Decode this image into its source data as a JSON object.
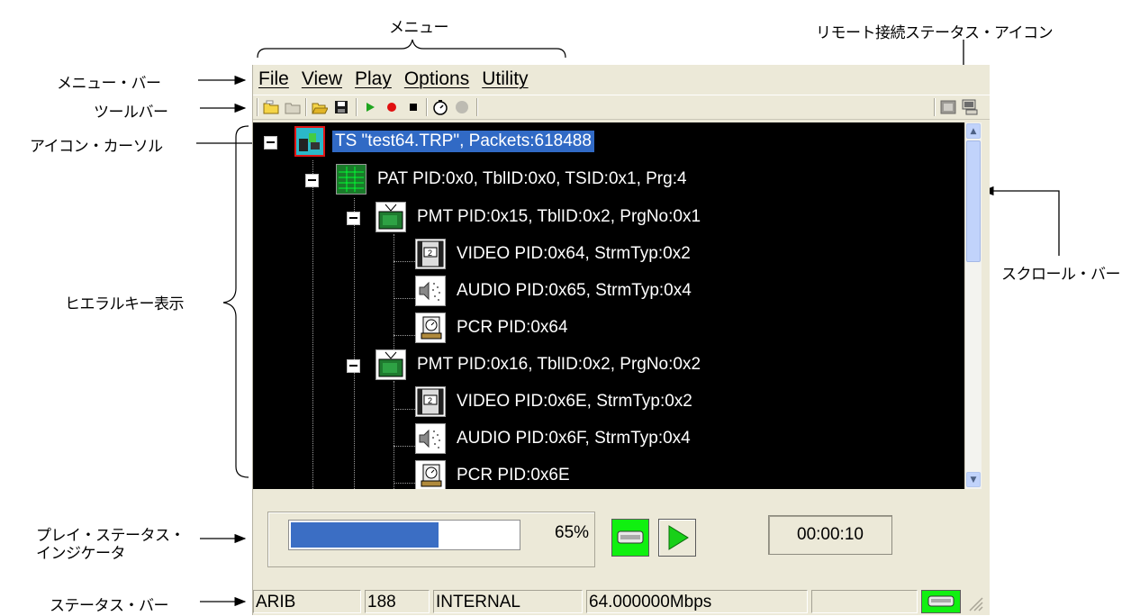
{
  "callouts": {
    "menu": "メニュー",
    "remote_icon": "リモート接続ステータス・アイコン",
    "menu_bar": "メニュー・バー",
    "toolbar": "ツールバー",
    "icon_cursor": "アイコン・カーソル",
    "hierarchy": "ヒエラルキー表示",
    "scroll_bar": "スクロール・バー",
    "play_status_line1": "プレイ・ステータス・",
    "play_status_line2": "インジケータ",
    "status_bar": "ステータス・バー"
  },
  "menu": {
    "items": [
      "File",
      "View",
      "Play",
      "Options",
      "Utility"
    ]
  },
  "toolbar": {
    "icons": [
      "new-folder-icon",
      "folder-icon",
      "open-icon",
      "save-icon",
      "play-icon",
      "record-icon",
      "stop-icon",
      "timer-icon",
      "status-light-icon"
    ],
    "right_icons": [
      "remote-image-icon",
      "remote-connection-icon"
    ]
  },
  "tree": {
    "nodes": [
      {
        "label": "TS \"test64.TRP\", Packets:618488",
        "icon": "transport-stream-icon",
        "selected": true
      },
      {
        "label": "PAT PID:0x0, TblID:0x0, TSID:0x1, Prg:4",
        "icon": "pat-table-icon"
      },
      {
        "label": "PMT PID:0x15, TblID:0x2, PrgNo:0x1",
        "icon": "tv-icon"
      },
      {
        "label": "VIDEO PID:0x64, StrmTyp:0x2",
        "icon": "film-icon"
      },
      {
        "label": "AUDIO PID:0x65, StrmTyp:0x4",
        "icon": "speaker-icon"
      },
      {
        "label": "PCR PID:0x64",
        "icon": "clock-icon"
      },
      {
        "label": "PMT PID:0x16, TblID:0x2, PrgNo:0x2",
        "icon": "tv-icon"
      },
      {
        "label": "VIDEO PID:0x6E, StrmTyp:0x2",
        "icon": "film-icon"
      },
      {
        "label": "AUDIO PID:0x6F, StrmTyp:0x4",
        "icon": "speaker-icon"
      },
      {
        "label": "PCR PID:0x6E",
        "icon": "clock-icon"
      }
    ]
  },
  "play": {
    "progress_percent": 65,
    "progress_text": "65%",
    "time": "00:00:10"
  },
  "status": {
    "standard": "ARIB",
    "packet_size": "188",
    "clock": "INTERNAL",
    "rate": "64.000000Mbps",
    "empty": ""
  },
  "colors": {
    "tree_background": "#000000",
    "selection": "#316ac5",
    "progress": "#3b6ec4",
    "active_green": "#10f010"
  }
}
